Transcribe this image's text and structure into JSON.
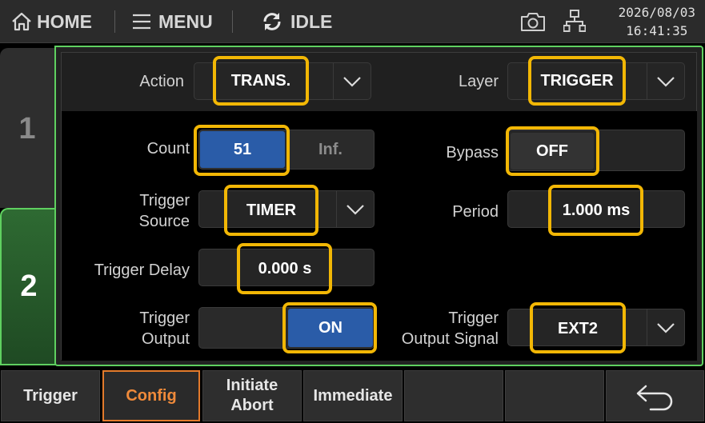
{
  "topbar": {
    "home_label": "HOME",
    "menu_label": "MENU",
    "status_label": "IDLE",
    "date": "2026/08/03",
    "time": "16:41:35",
    "icons": [
      "home-icon",
      "hamburger-icon",
      "sync-icon",
      "camera-icon",
      "network-icon"
    ]
  },
  "tabs": [
    {
      "label": "1",
      "active": false
    },
    {
      "label": "2",
      "active": true
    }
  ],
  "config": {
    "action": {
      "label": "Action",
      "value": "TRANS."
    },
    "layer": {
      "label": "Layer",
      "value": "TRIGGER"
    },
    "count": {
      "label": "Count",
      "value": "51",
      "inf_label": "Inf."
    },
    "bypass": {
      "label": "Bypass",
      "value": "OFF"
    },
    "trigger_source": {
      "label_line1": "Trigger",
      "label_line2": "Source",
      "value": "TIMER"
    },
    "period": {
      "label": "Period",
      "value": "1.000 ms"
    },
    "trigger_delay": {
      "label": "Trigger Delay",
      "value": "0.000 s"
    },
    "trigger_output": {
      "label_line1": "Trigger",
      "label_line2": "Output",
      "value": "ON"
    },
    "trigger_output_signal": {
      "label_line1": "Trigger",
      "label_line2": "Output Signal",
      "value": "EXT2"
    }
  },
  "softkeys": {
    "trigger": "Trigger",
    "config": "Config",
    "initiate_line1": "Initiate",
    "initiate_line2": "Abort",
    "immediate": "Immediate"
  },
  "colors": {
    "accent_green": "#5fd060",
    "highlight_yellow": "#f2b705",
    "selected_blue": "#2a5ca8",
    "active_softkey_orange": "#f08a3a"
  }
}
